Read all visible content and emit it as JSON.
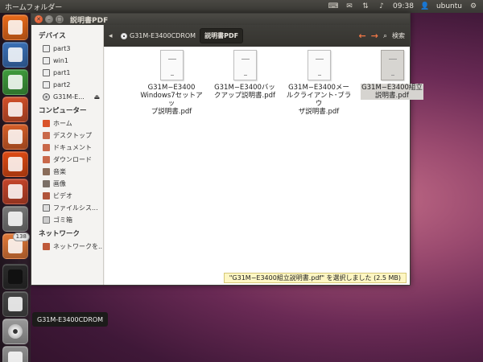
{
  "top_panel": {
    "title": "ホームフォルダー",
    "clock": "09:38",
    "user": "ubuntu"
  },
  "launcher": {
    "items": [
      {
        "name": "firefox",
        "color": "#e86a1b"
      },
      {
        "name": "writer",
        "color": "#3a6fb5"
      },
      {
        "name": "calc",
        "color": "#3f9a3c"
      },
      {
        "name": "impress",
        "color": "#d0502a"
      },
      {
        "name": "software-center",
        "color": "#d45e28"
      },
      {
        "name": "ubuntu-one",
        "color": "#dd4a14"
      },
      {
        "name": "settings",
        "color": "#c3442a"
      },
      {
        "name": "camera",
        "color": "#777777"
      },
      {
        "name": "home-folder",
        "color": "#e07838",
        "badge": "138"
      },
      {
        "name": "terminal",
        "color": "#2b2b2b"
      },
      {
        "name": "workspace",
        "color": "#444444"
      },
      {
        "name": "cdrom",
        "color": "#9a9a9a"
      },
      {
        "name": "trash",
        "color": "#8f8f8f"
      }
    ],
    "tooltip": "G31M-E3400CDROM"
  },
  "window": {
    "title": "説明書PDF",
    "breadcrumbs": [
      "G31M-E3400CDROM",
      "説明書PDF"
    ],
    "search_label": "検索"
  },
  "sidebar": {
    "sections": [
      {
        "heading": "デバイス",
        "items": [
          {
            "label": "part3",
            "icon": "drive"
          },
          {
            "label": "win1",
            "icon": "drive"
          },
          {
            "label": "part1",
            "icon": "drive"
          },
          {
            "label": "part2",
            "icon": "drive"
          },
          {
            "label": "G31M-E...",
            "icon": "disc",
            "eject": "⏏"
          }
        ]
      },
      {
        "heading": "コンピューター",
        "items": [
          {
            "label": "ホーム",
            "icon": "home"
          },
          {
            "label": "デスクトップ",
            "icon": "folder"
          },
          {
            "label": "ドキュメント",
            "icon": "folder"
          },
          {
            "label": "ダウンロード",
            "icon": "folder"
          },
          {
            "label": "音楽",
            "icon": "music"
          },
          {
            "label": "画像",
            "icon": "pic"
          },
          {
            "label": "ビデオ",
            "icon": "vid"
          },
          {
            "label": "ファイルシス...",
            "icon": "fs"
          },
          {
            "label": "ゴミ箱",
            "icon": "trash"
          }
        ]
      },
      {
        "heading": "ネットワーク",
        "items": [
          {
            "label": "ネットワークを...",
            "icon": "net"
          }
        ]
      }
    ]
  },
  "files": [
    {
      "lines": [
        "G31M−E3400",
        "Windows7セットアッ",
        "プ説明書.pdf"
      ],
      "selected": false
    },
    {
      "lines": [
        "G31M−E3400バッ",
        "クアップ説明書.pdf"
      ],
      "selected": false
    },
    {
      "lines": [
        "G31M−E3400メー",
        "ルクライアント･ブラウ",
        "ザ説明書.pdf"
      ],
      "selected": false
    },
    {
      "lines": [
        "G31M−E3400組立",
        "説明書.pdf"
      ],
      "selected": true
    }
  ],
  "status": "\"G31M−E3400組立説明書.pdf\" を選択しました (2.5 MB)"
}
